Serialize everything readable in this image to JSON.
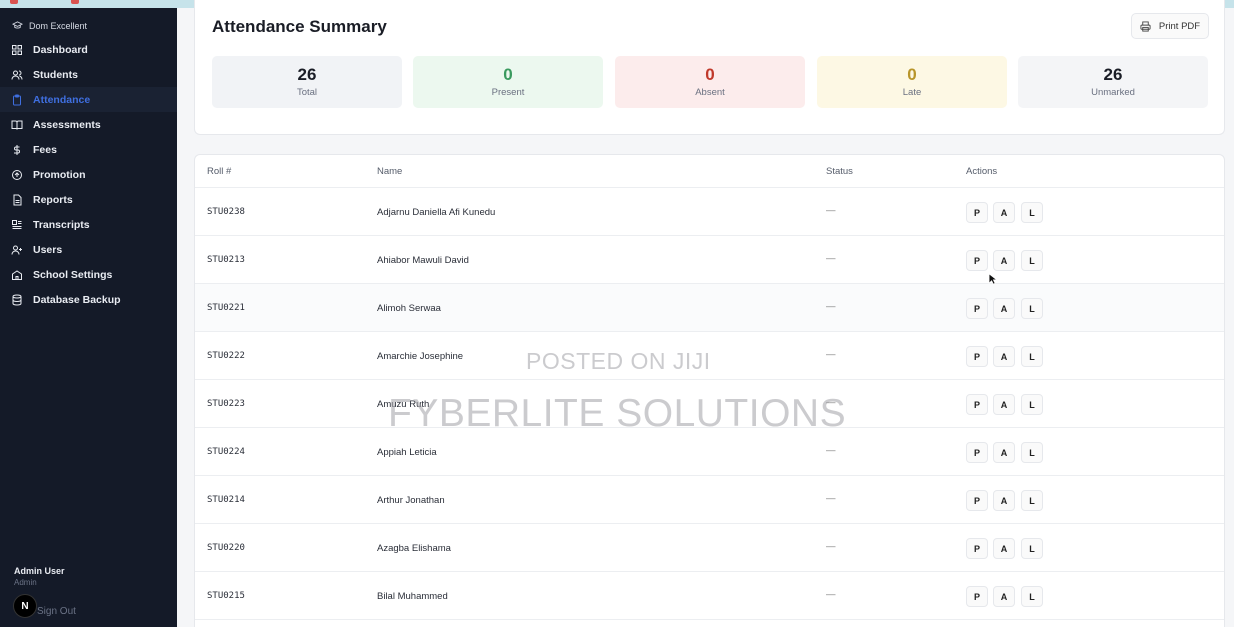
{
  "sidebar": {
    "brand": "Dom Excellent",
    "items": [
      {
        "label": "Dashboard",
        "icon": "dashboard-icon",
        "active": false
      },
      {
        "label": "Students",
        "icon": "users-icon",
        "active": false
      },
      {
        "label": "Attendance",
        "icon": "clipboard-icon",
        "active": true
      },
      {
        "label": "Assessments",
        "icon": "book-icon",
        "active": false
      },
      {
        "label": "Fees",
        "icon": "dollar-icon",
        "active": false
      },
      {
        "label": "Promotion",
        "icon": "arrow-circle-icon",
        "active": false
      },
      {
        "label": "Reports",
        "icon": "report-icon",
        "active": false
      },
      {
        "label": "Transcripts",
        "icon": "transcript-icon",
        "active": false
      },
      {
        "label": "Users",
        "icon": "user-plus-icon",
        "active": false
      },
      {
        "label": "School Settings",
        "icon": "school-icon",
        "active": false
      },
      {
        "label": "Database Backup",
        "icon": "database-icon",
        "active": false
      }
    ],
    "user": {
      "name": "Admin User",
      "role": "Admin"
    },
    "avatar_letter": "N",
    "signout": "Sign Out"
  },
  "summary": {
    "title": "Attendance Summary",
    "print_label": "Print PDF",
    "stats": [
      {
        "value": "26",
        "label": "Total",
        "color": "#1a1d26",
        "bg": "#f1f3f6"
      },
      {
        "value": "0",
        "label": "Present",
        "color": "#3a9a5e",
        "bg": "#ecf8ef"
      },
      {
        "value": "0",
        "label": "Absent",
        "color": "#c0392b",
        "bg": "#fcecec"
      },
      {
        "value": "0",
        "label": "Late",
        "color": "#b8952a",
        "bg": "#fdf8e4"
      },
      {
        "value": "26",
        "label": "Unmarked",
        "color": "#1a1d26",
        "bg": "#f4f5f7"
      }
    ]
  },
  "table": {
    "headers": {
      "roll": "Roll #",
      "name": "Name",
      "status": "Status",
      "actions": "Actions"
    },
    "action_labels": {
      "present": "P",
      "absent": "A",
      "late": "L"
    },
    "rows": [
      {
        "roll": "STU0238",
        "name": "Adjarnu Daniella Afi Kunedu",
        "status": "—"
      },
      {
        "roll": "STU0213",
        "name": "Ahiabor Mawuli David",
        "status": "—"
      },
      {
        "roll": "STU0221",
        "name": "Alimoh Serwaa",
        "status": "—"
      },
      {
        "roll": "STU0222",
        "name": "Amarchie Josephine",
        "status": "—"
      },
      {
        "roll": "STU0223",
        "name": "Amuzu Ruth",
        "status": "—"
      },
      {
        "roll": "STU0224",
        "name": "Appiah Leticia",
        "status": "—"
      },
      {
        "roll": "STU0214",
        "name": "Arthur Jonathan",
        "status": "—"
      },
      {
        "roll": "STU0220",
        "name": "Azagba Elishama",
        "status": "—"
      },
      {
        "roll": "STU0215",
        "name": "Bilal Muhammed",
        "status": "—"
      }
    ]
  },
  "watermark": {
    "line1": "POSTED ON JIJI",
    "line2": "FYBERLITE SOLUTIONS"
  }
}
